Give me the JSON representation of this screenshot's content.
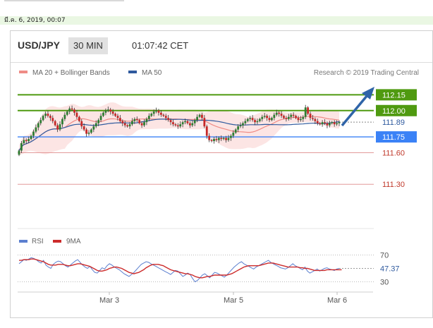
{
  "date_text": "มี.ค. 6, 2019, 00:07",
  "header": {
    "pair": "USD/JPY",
    "timeframe": "30 MIN",
    "time": "01:07:42 CET"
  },
  "legend": {
    "ma20_label": "MA 20 + Bollinger Bands",
    "ma50_label": "MA 50",
    "copyright": "Research © 2019 Trading Central"
  },
  "colors": {
    "up_candle": "#2e7d32",
    "down_candle": "#c62828",
    "ma20": "#ef8c86",
    "bollinger_fill": "#fbe1df",
    "ma50": "#2f5a9e",
    "level_green": "#4f9a10",
    "level_blue": "#3b82f6",
    "level_red": "#e39a9a",
    "arrow": "#2f64a8",
    "rsi": "#5b7fcf",
    "rsi_ma": "#cc2b2b"
  },
  "chart_data": [
    {
      "type": "candlestick",
      "title": "USD/JPY",
      "timeframe": "30 MIN",
      "x_ticks": [
        "Mar 3",
        "Mar 5",
        "Mar 6"
      ],
      "ylim": [
        111.0,
        112.3
      ],
      "grid": false,
      "legend_placement": "top-left",
      "last_price": 111.89,
      "levels": [
        {
          "label": "112.15",
          "value": 112.15,
          "kind": "resistance",
          "color": "#4f9a10"
        },
        {
          "label": "112.00",
          "value": 112.0,
          "kind": "resistance",
          "color": "#4f9a10"
        },
        {
          "label": "111.75",
          "value": 111.75,
          "kind": "pivot",
          "color": "#3b82f6"
        },
        {
          "label": "111.60",
          "value": 111.6,
          "kind": "support",
          "color": "#e39a9a"
        },
        {
          "label": "111.30",
          "value": 111.3,
          "kind": "support",
          "color": "#e39a9a"
        }
      ],
      "price_label": "111.89",
      "close": [
        111.62,
        111.69,
        111.72,
        111.71,
        111.73,
        111.76,
        111.8,
        111.84,
        111.88,
        111.91,
        111.95,
        111.97,
        111.95,
        111.93,
        111.9,
        111.86,
        111.82,
        111.87,
        111.92,
        111.96,
        111.99,
        112.02,
        112.01,
        111.98,
        111.94,
        111.9,
        111.85,
        111.82,
        111.78,
        111.79,
        111.82,
        111.85,
        111.88,
        111.91,
        111.95,
        111.98,
        112.0,
        112.01,
        111.99,
        111.97,
        111.95,
        111.93,
        111.9,
        111.88,
        111.86,
        111.85,
        111.87,
        111.9,
        111.92,
        111.91,
        111.88,
        111.86,
        111.89,
        111.92,
        111.95,
        111.97,
        111.99,
        112.0,
        111.98,
        111.96,
        111.95,
        111.93,
        111.91,
        111.89,
        111.87,
        111.86,
        111.85,
        111.87,
        111.89,
        111.9,
        111.88,
        111.86,
        111.88,
        111.91,
        111.94,
        111.96,
        111.93,
        111.85,
        111.76,
        111.72,
        111.71,
        111.73,
        111.72,
        111.74,
        111.73,
        111.74,
        111.72,
        111.74,
        111.76,
        111.79,
        111.82,
        111.85,
        111.86,
        111.88,
        111.9,
        111.92,
        111.93,
        111.91,
        111.89,
        111.9,
        111.92,
        111.94,
        111.95,
        111.93,
        111.91,
        111.93,
        111.96,
        111.98,
        111.97,
        111.95,
        111.93,
        111.92,
        111.94,
        111.96,
        111.95,
        111.93,
        111.91,
        111.92,
        111.94,
        112.03,
        111.97,
        111.93,
        111.92,
        111.9,
        111.88,
        111.87,
        111.89,
        111.88,
        111.86,
        111.88,
        111.89,
        111.87,
        111.88,
        111.89
      ]
    },
    {
      "type": "line",
      "title": "RSI",
      "series": [
        {
          "name": "RSI",
          "values": [
            57,
            60,
            63,
            62,
            64,
            66,
            65,
            63,
            60,
            58,
            62,
            55,
            52,
            50,
            56,
            59,
            61,
            60,
            57,
            54,
            52,
            55,
            58,
            61,
            63,
            59,
            55,
            52,
            50,
            53,
            48,
            44,
            43,
            47,
            51,
            49,
            54,
            57,
            55,
            52,
            50,
            48,
            45,
            42,
            40,
            38,
            41,
            44,
            48,
            52,
            56,
            58,
            60,
            59,
            57,
            55,
            53,
            51,
            49,
            47,
            45,
            43,
            41,
            44,
            47,
            46,
            42,
            38,
            40,
            43,
            41,
            35,
            30,
            32,
            36,
            40,
            42,
            39,
            36,
            40,
            44,
            43,
            41,
            39,
            37,
            40,
            44,
            48,
            52,
            55,
            58,
            60,
            57,
            55,
            53,
            51,
            49,
            52,
            54,
            56,
            58,
            60,
            62,
            59,
            57,
            55,
            53,
            51,
            50,
            49,
            51,
            54,
            57,
            54,
            52,
            50,
            48,
            52,
            46,
            43,
            45,
            47,
            49,
            46,
            48,
            50,
            51,
            49,
            48,
            47,
            49,
            50
          ]
        },
        {
          "name": "9MA",
          "values": [
            62,
            62,
            63,
            63,
            63,
            64,
            64,
            63,
            62,
            61,
            60,
            58,
            56,
            55,
            55,
            55,
            56,
            56,
            56,
            55,
            54,
            54,
            55,
            56,
            57,
            57,
            56,
            55,
            54,
            53,
            51,
            49,
            47,
            46,
            46,
            47,
            48,
            50,
            51,
            52,
            52,
            51,
            50,
            48,
            46,
            44,
            43,
            42,
            43,
            44,
            46,
            48,
            51,
            53,
            55,
            56,
            56,
            56,
            55,
            54,
            52,
            50,
            48,
            47,
            46,
            45,
            44,
            43,
            42,
            42,
            41,
            40,
            38,
            37,
            36,
            36,
            37,
            38,
            38,
            39,
            40,
            40,
            40,
            40,
            40,
            40,
            41,
            42,
            44,
            46,
            48,
            50,
            52,
            53,
            54,
            54,
            54,
            54,
            54,
            55,
            56,
            57,
            58,
            58,
            58,
            57,
            56,
            55,
            54,
            53,
            52,
            52,
            52,
            52,
            52,
            51,
            51,
            50,
            50,
            49,
            48,
            47,
            47,
            47,
            47,
            47,
            48,
            48,
            48,
            48,
            48,
            48,
            48
          ]
        }
      ],
      "levels": [
        70,
        30
      ],
      "level_labels": [
        "70",
        "30"
      ],
      "last_value_label": "47.37",
      "ylim": [
        20,
        80
      ]
    }
  ]
}
